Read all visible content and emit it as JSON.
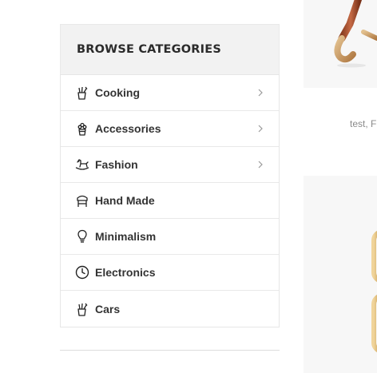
{
  "sidebar": {
    "title": "BROWSE CATEGORIES",
    "items": [
      {
        "label": "Cooking",
        "icon": "cooking-utensils-icon",
        "has_submenu": true
      },
      {
        "label": "Accessories",
        "icon": "plant-pot-icon",
        "has_submenu": true
      },
      {
        "label": "Fashion",
        "icon": "rocking-horse-icon",
        "has_submenu": true
      },
      {
        "label": "Hand Made",
        "icon": "chair-icon",
        "has_submenu": false
      },
      {
        "label": "Minimalism",
        "icon": "light-bulb-icon",
        "has_submenu": false
      },
      {
        "label": "Electronics",
        "icon": "clock-icon",
        "has_submenu": false
      },
      {
        "label": "Cars",
        "icon": "cooking-utensils-icon",
        "has_submenu": false
      }
    ]
  },
  "product": {
    "caption": "test, F"
  }
}
